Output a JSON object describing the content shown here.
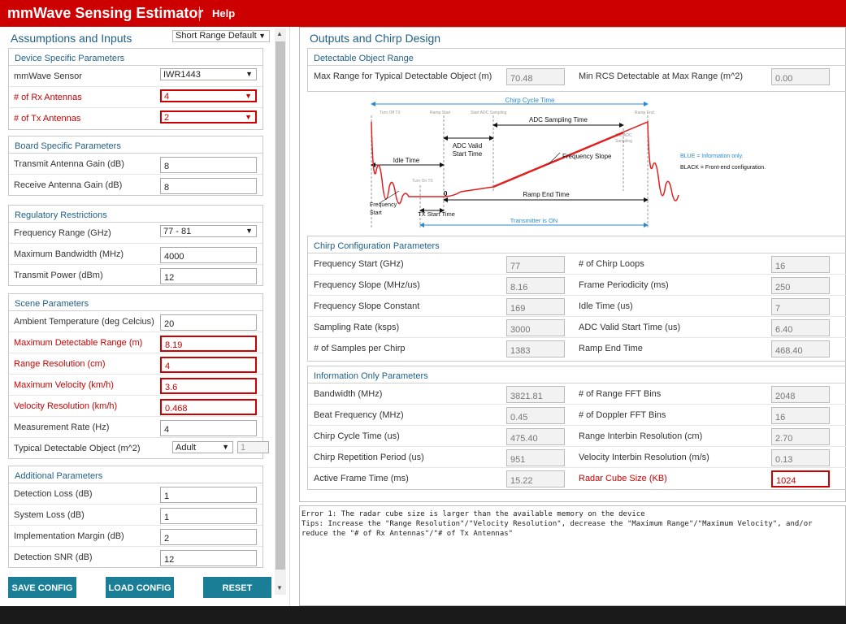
{
  "app": {
    "title": "mmWave Sensing Estimator",
    "help": "Help"
  },
  "left": {
    "title": "Assumptions and Inputs",
    "preset": "Short Range Default",
    "device": {
      "title": "Device Specific Parameters",
      "sensor_label": "mmWave Sensor",
      "sensor_value": "IWR1443",
      "rx_label": "# of Rx Antennas",
      "rx_value": "4",
      "tx_label": "# of Tx Antennas",
      "tx_value": "2"
    },
    "board": {
      "title": "Board Specific Parameters",
      "tx_gain_label": "Transmit Antenna Gain (dB)",
      "tx_gain_value": "8",
      "rx_gain_label": "Receive Antenna Gain (dB)",
      "rx_gain_value": "8"
    },
    "regulatory": {
      "title": "Regulatory Restrictions",
      "freq_label": "Frequency Range (GHz)",
      "freq_value": "77 - 81",
      "bw_label": "Maximum Bandwidth (MHz)",
      "bw_value": "4000",
      "power_label": "Transmit Power (dBm)",
      "power_value": "12"
    },
    "scene": {
      "title": "Scene Parameters",
      "temp_label": "Ambient Temperature (deg Celcius)",
      "temp_value": "20",
      "range_label": "Maximum Detectable Range (m)",
      "range_value": "8.19",
      "res_label": "Range Resolution (cm)",
      "res_value": "4",
      "vel_label": "Maximum Velocity (km/h)",
      "vel_value": "3.6",
      "velres_label": "Velocity Resolution (km/h)",
      "velres_value": "0.468",
      "rate_label": "Measurement Rate (Hz)",
      "rate_value": "4",
      "object_label": "Typical Detectable Object (m^2)",
      "object_value": "Adult",
      "object_rcs": "1"
    },
    "additional": {
      "title": "Additional Parameters",
      "det_loss_label": "Detection Loss (dB)",
      "det_loss_value": "1",
      "sys_loss_label": "System Loss (dB)",
      "sys_loss_value": "1",
      "margin_label": "Implementation Margin (dB)",
      "margin_value": "2",
      "snr_label": "Detection SNR (dB)",
      "snr_value": "12"
    },
    "buttons": {
      "save": "SAVE CONFIG",
      "load": "LOAD CONFIG",
      "reset": "RESET"
    }
  },
  "right": {
    "title": "Outputs and Chirp Design",
    "detectable": {
      "title": "Detectable Object Range",
      "max_range_label": "Max Range for Typical Detectable Object (m)",
      "max_range_value": "70.48",
      "min_rcs_label": "Min RCS Detectable at Max Range (m^2)",
      "min_rcs_value": "0.00"
    },
    "diagram": {
      "chirp_cycle": "Chirp Cycle Time",
      "turn_off_tx": "Turn Off TX",
      "ramp_start": "Ramp Start",
      "start_adc": "Start ADC Sampling",
      "ramp_end": "Ramp End",
      "adc_sampling": "ADC Sampling Time",
      "end_adc_1": "End ADC",
      "end_adc_2": "Sampling",
      "idle_time": "Idle Time",
      "adc_valid_1": "ADC Valid",
      "adc_valid_2": "Start Time",
      "freq_slope": "Frequency Slope",
      "blue_note": "BLUE = Information only.",
      "black_note": "BLACK = Front-end configuration.",
      "turn_on_tx": "Turn On TX",
      "zero": "0",
      "ramp_end_time": "Ramp End Time",
      "freq_start_1": "Frequency",
      "freq_start_2": "Start",
      "tx_start": "TX Start Time",
      "tx_on": "Transmitter is ON"
    },
    "chirp": {
      "title": "Chirp Configuration Parameters",
      "rows": [
        {
          "l_label": "Frequency Start (GHz)",
          "l_value": "77",
          "r_label": "# of Chirp Loops",
          "r_value": "16"
        },
        {
          "l_label": "Frequency Slope (MHz/us)",
          "l_value": "8.16",
          "r_label": "Frame Periodicity (ms)",
          "r_value": "250"
        },
        {
          "l_label": "Frequency Slope Constant",
          "l_value": "169",
          "r_label": "Idle Time (us)",
          "r_value": "7"
        },
        {
          "l_label": "Sampling Rate (ksps)",
          "l_value": "3000",
          "r_label": "ADC Valid Start Time (us)",
          "r_value": "6.40"
        },
        {
          "l_label": "# of Samples per Chirp",
          "l_value": "1383",
          "r_label": "Ramp End Time",
          "r_value": "468.40"
        }
      ]
    },
    "info": {
      "title": "Information Only Parameters",
      "rows": [
        {
          "l_label": "Bandwidth (MHz)",
          "l_value": "3821.81",
          "r_label": "# of Range FFT Bins",
          "r_value": "2048"
        },
        {
          "l_label": "Beat Frequency (MHz)",
          "l_value": "0.45",
          "r_label": "# of Doppler FFT Bins",
          "r_value": "16"
        },
        {
          "l_label": "Chirp Cycle Time (us)",
          "l_value": "475.40",
          "r_label": "Range Interbin Resolution (cm)",
          "r_value": "2.70"
        },
        {
          "l_label": "Chirp Repetition Period (us)",
          "l_value": "951",
          "r_label": "Velocity Interbin Resolution (m/s)",
          "r_value": "0.13"
        },
        {
          "l_label": "Active Frame Time (ms)",
          "l_value": "15.22",
          "r_label": "Radar Cube Size (KB)",
          "r_value": "1024"
        }
      ]
    }
  },
  "console": "Error 1: The radar cube size is larger than the available memory on the device\nTips: Increase the \"Range Resolution\"/\"Velocity Resolution\", decrease the \"Maximum Range\"/\"Maximum Velocity\", and/or\nreduce the \"# of Rx Antennas\"/\"# of Tx Antennas\"",
  "colors": {
    "brand": "#cc0000",
    "accent": "#1a7e96",
    "section_title": "#1f5f88",
    "error": "#cc0000",
    "diagram_blue": "#2a8ad6"
  }
}
